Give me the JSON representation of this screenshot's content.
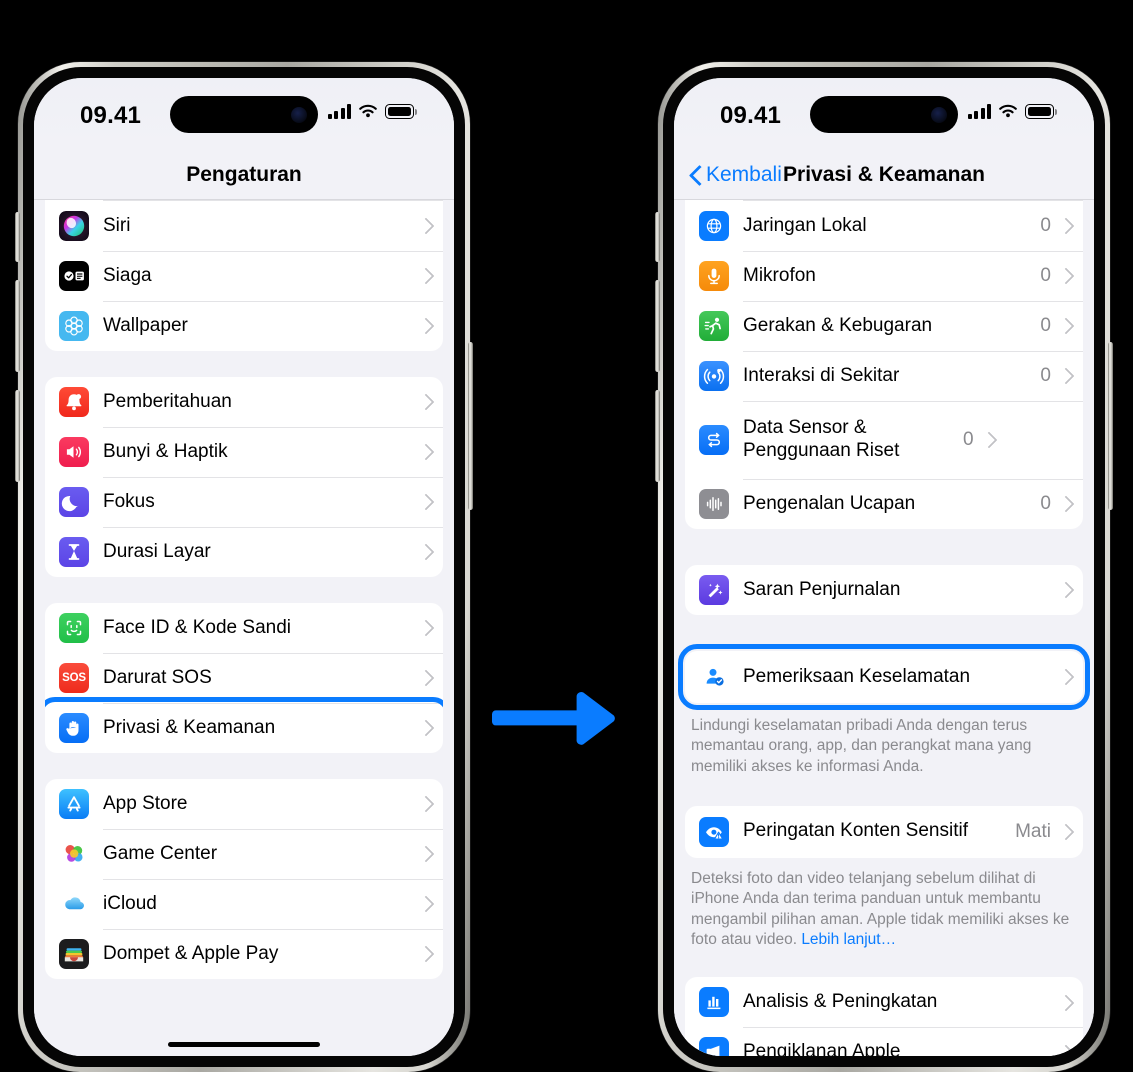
{
  "background_color": "#000000",
  "accent_color": "#0a7cff",
  "arrow": {
    "name": "right-arrow",
    "color": "#0a7cff"
  },
  "phones": [
    {
      "id": "settings",
      "status_bar": {
        "time": "09.41",
        "cellular": "signal-bars-icon",
        "wifi": "wifi-icon",
        "battery": "battery-full-icon"
      },
      "nav": {
        "title": "Pengaturan",
        "back_label": null
      },
      "groups": [
        {
          "id": "group-siri",
          "partial_top": true,
          "rows": [
            {
              "label": "Siri",
              "icon": "siri-icon",
              "value": "",
              "chevron": true
            },
            {
              "label": "Siaga",
              "icon": "standby-icon",
              "value": "",
              "chevron": true
            },
            {
              "label": "Wallpaper",
              "icon": "wallpaper-icon",
              "value": "",
              "chevron": true
            }
          ]
        },
        {
          "id": "group-notifications",
          "rows": [
            {
              "label": "Pemberitahuan",
              "icon": "notifications-icon",
              "value": "",
              "chevron": true
            },
            {
              "label": "Bunyi & Haptik",
              "icon": "sounds-haptics-icon",
              "value": "",
              "chevron": true
            },
            {
              "label": "Fokus",
              "icon": "focus-icon",
              "value": "",
              "chevron": true
            },
            {
              "label": "Durasi Layar",
              "icon": "screen-time-icon",
              "value": "",
              "chevron": true
            }
          ]
        },
        {
          "id": "group-security",
          "highlight_row_index": 2,
          "rows": [
            {
              "label": "Face ID & Kode Sandi",
              "icon": "face-id-icon",
              "value": "",
              "chevron": true
            },
            {
              "label": "Darurat SOS",
              "icon": "emergency-sos-icon",
              "value": "",
              "chevron": true
            },
            {
              "label": "Privasi & Keamanan",
              "icon": "privacy-hand-icon",
              "value": "",
              "chevron": true
            }
          ]
        },
        {
          "id": "group-services",
          "rows": [
            {
              "label": "App Store",
              "icon": "app-store-icon",
              "value": "",
              "chevron": true
            },
            {
              "label": "Game Center",
              "icon": "game-center-icon",
              "value": "",
              "chevron": true
            },
            {
              "label": "iCloud",
              "icon": "icloud-icon",
              "value": "",
              "chevron": true
            },
            {
              "label": "Dompet & Apple Pay",
              "icon": "wallet-icon",
              "value": "",
              "chevron": true
            }
          ]
        }
      ]
    },
    {
      "id": "privacy",
      "status_bar": {
        "time": "09.41",
        "cellular": "signal-bars-icon",
        "wifi": "wifi-icon",
        "battery": "battery-full-icon"
      },
      "nav": {
        "title": "Privasi & Keamanan",
        "back_label": "Kembali"
      },
      "groups": [
        {
          "id": "group-permissions",
          "partial_top": true,
          "rows": [
            {
              "label": "Jaringan Lokal",
              "icon": "local-network-icon",
              "value": "0",
              "chevron": true
            },
            {
              "label": "Mikrofon",
              "icon": "microphone-icon",
              "value": "0",
              "chevron": true
            },
            {
              "label": "Gerakan & Kebugaran",
              "icon": "motion-fitness-icon",
              "value": "0",
              "chevron": true
            },
            {
              "label": "Interaksi di Sekitar",
              "icon": "nearby-interactions-icon",
              "value": "0",
              "chevron": true
            },
            {
              "label": "Data Sensor & Penggunaan Riset",
              "icon": "sensor-research-icon",
              "value": "0",
              "chevron": true
            },
            {
              "label": "Pengenalan Ucapan",
              "icon": "speech-recognition-icon",
              "value": "0",
              "chevron": true
            }
          ]
        },
        {
          "id": "group-journaling",
          "rows": [
            {
              "label": "Saran Penjurnalan",
              "icon": "journaling-suggestions-icon",
              "value": "",
              "chevron": true
            }
          ]
        },
        {
          "id": "group-safety-check",
          "highlighted": true,
          "rows": [
            {
              "label": "Pemeriksaan Keselamatan",
              "icon": "safety-check-icon",
              "value": "",
              "chevron": true
            }
          ],
          "footnote": "Lindungi keselamatan pribadi Anda dengan terus memantau orang, app, dan perangkat mana yang memiliki akses ke informasi Anda."
        },
        {
          "id": "group-sensitive-content",
          "rows": [
            {
              "label": "Peringatan Konten Sensitif",
              "icon": "sensitive-content-icon",
              "value": "Mati",
              "chevron": true
            }
          ],
          "footnote": "Deteksi foto dan video telanjang sebelum dilihat di iPhone Anda dan terima panduan untuk membantu mengambil pilihan aman. Apple tidak memiliki akses ke foto atau video. ",
          "footnote_link": "Lebih lanjut…"
        },
        {
          "id": "group-analytics",
          "rows": [
            {
              "label": "Analisis & Peningkatan",
              "icon": "analytics-icon",
              "value": "",
              "chevron": true
            },
            {
              "label": "Pengiklanan Apple",
              "icon": "apple-advertising-icon",
              "value": "",
              "chevron": true
            }
          ]
        }
      ]
    }
  ]
}
